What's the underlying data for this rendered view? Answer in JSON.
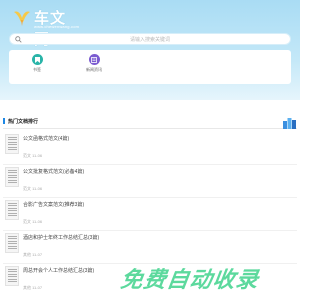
{
  "header": {
    "logo_text": "车文网",
    "logo_sub": "www.chewenwang.com"
  },
  "search": {
    "placeholder": "请输入搜索关键词"
  },
  "shortcuts": [
    {
      "label": "书签",
      "icon": "bookmark-icon",
      "color": "#2ab4a8"
    },
    {
      "label": "新闻资讯",
      "icon": "news-icon",
      "color": "#7b5bd0"
    }
  ],
  "section": {
    "title": "热门文档排行"
  },
  "docs": [
    {
      "title": "公文函格式范文(4篇)",
      "meta": "范文  11-06"
    },
    {
      "title": "公文批复格式范文(必备4篇)",
      "meta": "范文  11-06"
    },
    {
      "title": "合影广告文案范文(推荐3篇)",
      "meta": "范文  11-06"
    },
    {
      "title": "酒店和护士年终工作总结汇总(3篇)",
      "meta": "其他  11-07"
    },
    {
      "title": "周总开会个人工作总结汇总(3篇)",
      "meta": "其他  11-07"
    }
  ],
  "watermark": "免费自动收录",
  "colors": {
    "hero": "#a9dcf4",
    "accent": "#1e88e5",
    "watermark": "#40d28c"
  }
}
